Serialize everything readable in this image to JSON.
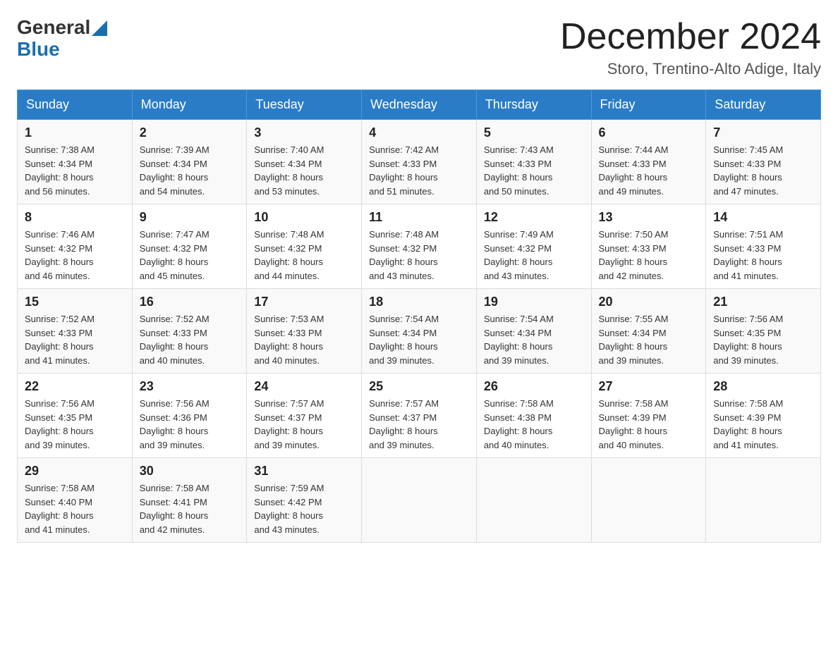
{
  "header": {
    "logo_general": "General",
    "logo_blue": "Blue",
    "month_title": "December 2024",
    "location": "Storo, Trentino-Alto Adige, Italy"
  },
  "days_of_week": [
    "Sunday",
    "Monday",
    "Tuesday",
    "Wednesday",
    "Thursday",
    "Friday",
    "Saturday"
  ],
  "weeks": [
    [
      {
        "day": "1",
        "sunrise": "7:38 AM",
        "sunset": "4:34 PM",
        "daylight": "8 hours and 56 minutes."
      },
      {
        "day": "2",
        "sunrise": "7:39 AM",
        "sunset": "4:34 PM",
        "daylight": "8 hours and 54 minutes."
      },
      {
        "day": "3",
        "sunrise": "7:40 AM",
        "sunset": "4:34 PM",
        "daylight": "8 hours and 53 minutes."
      },
      {
        "day": "4",
        "sunrise": "7:42 AM",
        "sunset": "4:33 PM",
        "daylight": "8 hours and 51 minutes."
      },
      {
        "day": "5",
        "sunrise": "7:43 AM",
        "sunset": "4:33 PM",
        "daylight": "8 hours and 50 minutes."
      },
      {
        "day": "6",
        "sunrise": "7:44 AM",
        "sunset": "4:33 PM",
        "daylight": "8 hours and 49 minutes."
      },
      {
        "day": "7",
        "sunrise": "7:45 AM",
        "sunset": "4:33 PM",
        "daylight": "8 hours and 47 minutes."
      }
    ],
    [
      {
        "day": "8",
        "sunrise": "7:46 AM",
        "sunset": "4:32 PM",
        "daylight": "8 hours and 46 minutes."
      },
      {
        "day": "9",
        "sunrise": "7:47 AM",
        "sunset": "4:32 PM",
        "daylight": "8 hours and 45 minutes."
      },
      {
        "day": "10",
        "sunrise": "7:48 AM",
        "sunset": "4:32 PM",
        "daylight": "8 hours and 44 minutes."
      },
      {
        "day": "11",
        "sunrise": "7:48 AM",
        "sunset": "4:32 PM",
        "daylight": "8 hours and 43 minutes."
      },
      {
        "day": "12",
        "sunrise": "7:49 AM",
        "sunset": "4:32 PM",
        "daylight": "8 hours and 43 minutes."
      },
      {
        "day": "13",
        "sunrise": "7:50 AM",
        "sunset": "4:33 PM",
        "daylight": "8 hours and 42 minutes."
      },
      {
        "day": "14",
        "sunrise": "7:51 AM",
        "sunset": "4:33 PM",
        "daylight": "8 hours and 41 minutes."
      }
    ],
    [
      {
        "day": "15",
        "sunrise": "7:52 AM",
        "sunset": "4:33 PM",
        "daylight": "8 hours and 41 minutes."
      },
      {
        "day": "16",
        "sunrise": "7:52 AM",
        "sunset": "4:33 PM",
        "daylight": "8 hours and 40 minutes."
      },
      {
        "day": "17",
        "sunrise": "7:53 AM",
        "sunset": "4:33 PM",
        "daylight": "8 hours and 40 minutes."
      },
      {
        "day": "18",
        "sunrise": "7:54 AM",
        "sunset": "4:34 PM",
        "daylight": "8 hours and 39 minutes."
      },
      {
        "day": "19",
        "sunrise": "7:54 AM",
        "sunset": "4:34 PM",
        "daylight": "8 hours and 39 minutes."
      },
      {
        "day": "20",
        "sunrise": "7:55 AM",
        "sunset": "4:34 PM",
        "daylight": "8 hours and 39 minutes."
      },
      {
        "day": "21",
        "sunrise": "7:56 AM",
        "sunset": "4:35 PM",
        "daylight": "8 hours and 39 minutes."
      }
    ],
    [
      {
        "day": "22",
        "sunrise": "7:56 AM",
        "sunset": "4:35 PM",
        "daylight": "8 hours and 39 minutes."
      },
      {
        "day": "23",
        "sunrise": "7:56 AM",
        "sunset": "4:36 PM",
        "daylight": "8 hours and 39 minutes."
      },
      {
        "day": "24",
        "sunrise": "7:57 AM",
        "sunset": "4:37 PM",
        "daylight": "8 hours and 39 minutes."
      },
      {
        "day": "25",
        "sunrise": "7:57 AM",
        "sunset": "4:37 PM",
        "daylight": "8 hours and 39 minutes."
      },
      {
        "day": "26",
        "sunrise": "7:58 AM",
        "sunset": "4:38 PM",
        "daylight": "8 hours and 40 minutes."
      },
      {
        "day": "27",
        "sunrise": "7:58 AM",
        "sunset": "4:39 PM",
        "daylight": "8 hours and 40 minutes."
      },
      {
        "day": "28",
        "sunrise": "7:58 AM",
        "sunset": "4:39 PM",
        "daylight": "8 hours and 41 minutes."
      }
    ],
    [
      {
        "day": "29",
        "sunrise": "7:58 AM",
        "sunset": "4:40 PM",
        "daylight": "8 hours and 41 minutes."
      },
      {
        "day": "30",
        "sunrise": "7:58 AM",
        "sunset": "4:41 PM",
        "daylight": "8 hours and 42 minutes."
      },
      {
        "day": "31",
        "sunrise": "7:59 AM",
        "sunset": "4:42 PM",
        "daylight": "8 hours and 43 minutes."
      },
      null,
      null,
      null,
      null
    ]
  ],
  "sunrise_label": "Sunrise:",
  "sunset_label": "Sunset:",
  "daylight_label": "Daylight:"
}
